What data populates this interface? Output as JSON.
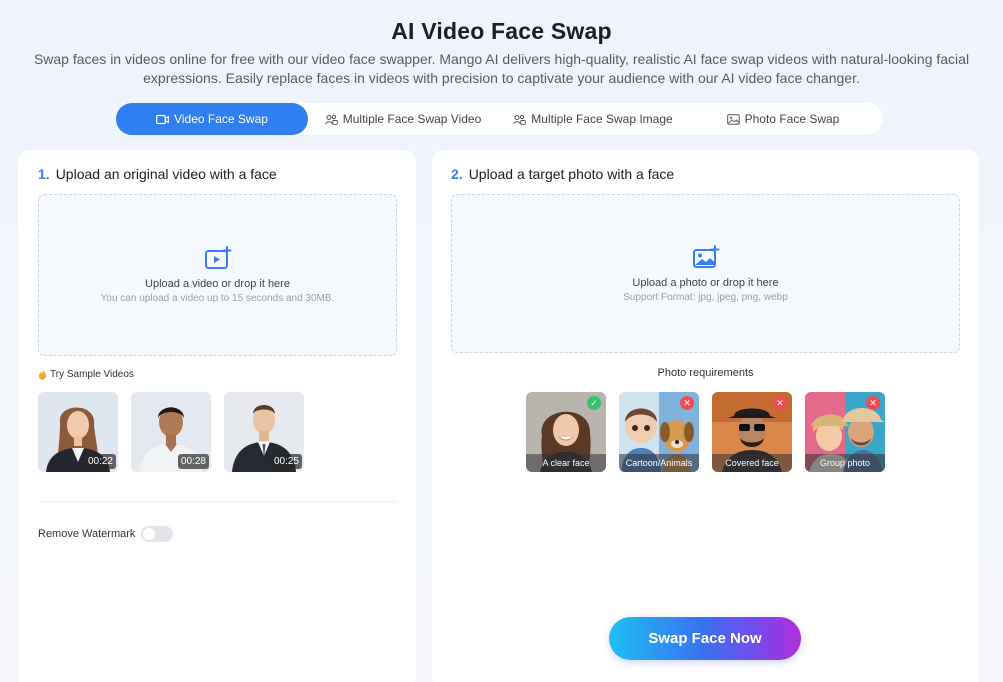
{
  "header": {
    "title": "AI Video Face Swap",
    "subtitle": "Swap faces in videos online for free with our video face swapper. Mango AI delivers high-quality, realistic AI face swap videos with natural-looking facial expressions. Easily replace faces in videos with precision to captivate your audience with our AI video face changer."
  },
  "tabs": [
    {
      "label": "Video Face Swap",
      "icon": "video-icon",
      "active": true
    },
    {
      "label": "Multiple Face Swap Video",
      "icon": "multi-face-icon",
      "active": false
    },
    {
      "label": "Multiple Face Swap Image",
      "icon": "multi-face-icon",
      "active": false
    },
    {
      "label": "Photo Face Swap",
      "icon": "image-icon",
      "active": false
    }
  ],
  "left_panel": {
    "step_number": "1.",
    "step_title": "Upload an original video with a face",
    "dropzone_main": "Upload a video or drop it here",
    "dropzone_sub": "You can upload a video up to 15 seconds and 30MB.",
    "sample_label": "Try Sample Videos",
    "samples": [
      {
        "duration": "00:22"
      },
      {
        "duration": "00:28"
      },
      {
        "duration": "00:25"
      }
    ],
    "watermark_label": "Remove Watermark",
    "watermark_enabled": false
  },
  "right_panel": {
    "step_number": "2.",
    "step_title": "Upload a target photo with a face",
    "dropzone_main": "Upload a photo or drop it here",
    "dropzone_sub": "Support Format: jpg, jpeg, png, webp",
    "requirements_title": "Photo requirements",
    "requirements": [
      {
        "caption": "A clear face",
        "status": "ok"
      },
      {
        "caption": "Cartoon/Animals",
        "status": "no"
      },
      {
        "caption": "Covered face",
        "status": "no"
      },
      {
        "caption": "Group photo",
        "status": "no"
      }
    ],
    "swap_button": "Swap Face Now"
  },
  "colors": {
    "accent": "#2f7ff0",
    "ok": "#35c16f",
    "error": "#f04a55"
  }
}
